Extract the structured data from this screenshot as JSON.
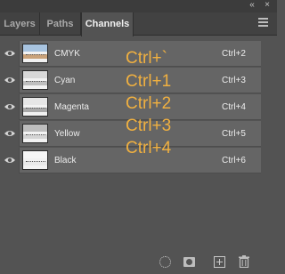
{
  "panel": {
    "tabs": [
      {
        "label": "Layers",
        "active": false
      },
      {
        "label": "Paths",
        "active": false
      },
      {
        "label": "Channels",
        "active": true
      }
    ],
    "collapse_glyph": "«",
    "close_glyph": "×"
  },
  "channels": [
    {
      "name": "CMYK",
      "shortcut": "Ctrl+2",
      "thumb_sky": "#a8c4e0",
      "thumb_ground": "#c9a27a"
    },
    {
      "name": "Cyan",
      "shortcut": "Ctrl+3",
      "thumb_sky": "#d8d8d8",
      "thumb_ground": "#bfbfbf"
    },
    {
      "name": "Magenta",
      "shortcut": "Ctrl+4",
      "thumb_sky": "#e6e6e6",
      "thumb_ground": "#a9a9a9"
    },
    {
      "name": "Yellow",
      "shortcut": "Ctrl+5",
      "thumb_sky": "#bdbdbd",
      "thumb_ground": "#d4d4d4"
    },
    {
      "name": "Black",
      "shortcut": "Ctrl+6",
      "thumb_sky": "#f6f6f6",
      "thumb_ground": "#e9e9e9"
    }
  ],
  "annotations": [
    "Ctrl+`",
    "Ctrl+1",
    "Ctrl+2",
    "Ctrl+3",
    "Ctrl+4"
  ],
  "colors": {
    "panel_bg": "#535353",
    "row_bg": "#656565",
    "annotation": "#f0b040"
  },
  "bottom_icons": [
    "load-selection-icon",
    "save-selection-mask-icon",
    "new-channel-icon",
    "delete-channel-icon"
  ]
}
